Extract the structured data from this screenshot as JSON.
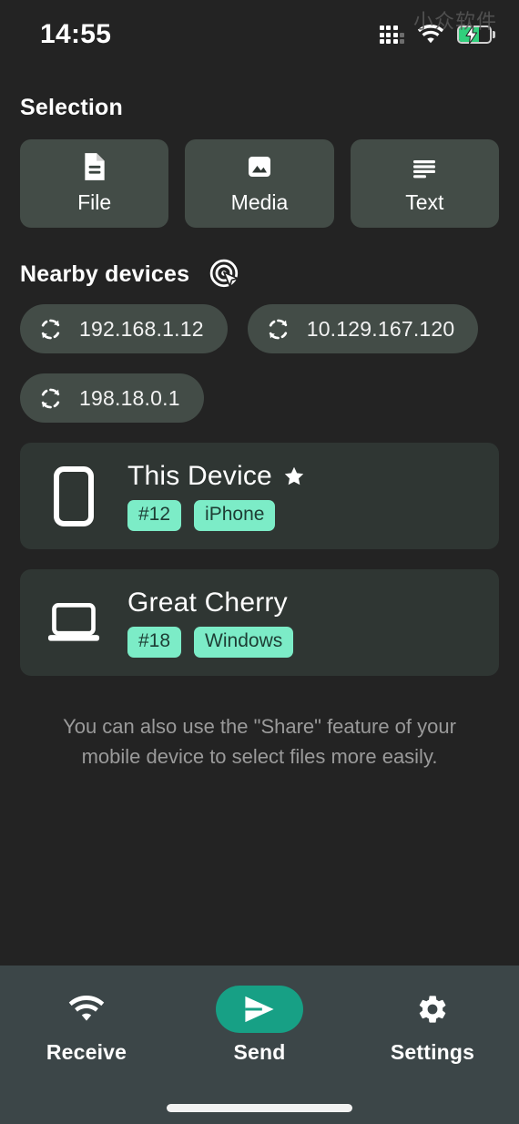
{
  "status_bar": {
    "time": "14:55",
    "signal_icon": "signal-dots-icon",
    "wifi_icon": "wifi-icon",
    "battery_icon": "battery-charging-icon",
    "watermark": "小众软件"
  },
  "selection": {
    "title": "Selection",
    "items": [
      {
        "label": "File",
        "icon": "file-document-icon"
      },
      {
        "label": "Media",
        "icon": "image-icon"
      },
      {
        "label": "Text",
        "icon": "text-lines-icon"
      }
    ]
  },
  "nearby": {
    "title": "Nearby devices",
    "scan_icon": "scan-target-cursor-icon",
    "addresses": [
      {
        "ip": "192.168.1.12",
        "icon": "sync-icon"
      },
      {
        "ip": "10.129.167.120",
        "icon": "sync-icon"
      },
      {
        "ip": "198.18.0.1",
        "icon": "sync-icon"
      }
    ]
  },
  "devices": [
    {
      "name": "This Device",
      "icon": "phone-icon",
      "starred": true,
      "star_icon": "star-icon",
      "badge_id": "#12",
      "badge_os": "iPhone"
    },
    {
      "name": "Great Cherry",
      "icon": "laptop-icon",
      "starred": false,
      "star_icon": "",
      "badge_id": "#18",
      "badge_os": "Windows"
    }
  ],
  "hint": "You can also use the \"Share\" feature of your mobile device to select files more easily.",
  "bottom_nav": {
    "items": [
      {
        "label": "Receive",
        "icon": "wifi-icon",
        "active": false
      },
      {
        "label": "Send",
        "icon": "send-icon",
        "active": true
      },
      {
        "label": "Settings",
        "icon": "gear-icon",
        "active": false
      }
    ]
  },
  "colors": {
    "page_background": "#232323",
    "card": "#434c47",
    "device_card": "#2f3633",
    "accent": "#17a085",
    "badge": "#7cecc7",
    "nav_background": "#3c4648",
    "battery_green": "#31d07c"
  }
}
